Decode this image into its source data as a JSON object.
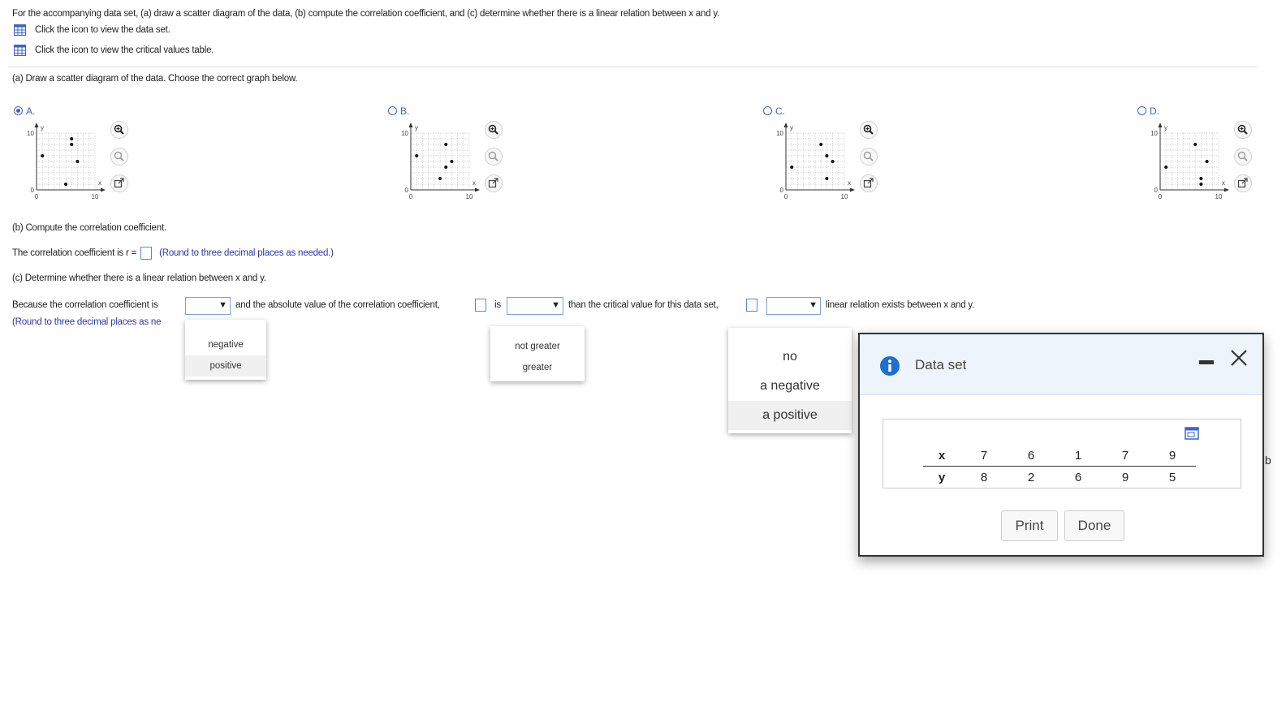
{
  "header": {
    "question": "For the accompanying data set, (a) draw a scatter diagram of the data, (b) compute the correlation coefficient, and (c) determine whether there is a linear relation between x and y.",
    "data_link": "Click the icon to view the data set.",
    "critical_link": "Click the icon to view the critical values table."
  },
  "part_a": {
    "prompt": "(a) Draw a scatter diagram of the data. Choose the correct graph below.",
    "options": [
      {
        "label": "A.",
        "selected": true
      },
      {
        "label": "B.",
        "selected": false
      },
      {
        "label": "C.",
        "selected": false
      },
      {
        "label": "D.",
        "selected": false
      }
    ],
    "axis": {
      "y_top": "10",
      "y_bottom": "0",
      "x_left": "0",
      "x_right": "10",
      "x_name": "x",
      "y_name": "y"
    },
    "graph_points": [
      [
        [
          1,
          6
        ],
        [
          6,
          9
        ],
        [
          6,
          8
        ],
        [
          7,
          5
        ],
        [
          5,
          1
        ]
      ],
      [
        [
          1,
          6
        ],
        [
          6,
          8
        ],
        [
          7,
          5
        ],
        [
          6,
          4
        ],
        [
          5,
          2
        ]
      ],
      [
        [
          1,
          4
        ],
        [
          6,
          8
        ],
        [
          7,
          6
        ],
        [
          8,
          5
        ],
        [
          7,
          2
        ]
      ],
      [
        [
          1,
          4
        ],
        [
          6,
          8
        ],
        [
          8,
          5
        ],
        [
          7,
          2
        ],
        [
          7,
          1
        ]
      ]
    ]
  },
  "part_b": {
    "prompt": "(b) Compute the correlation coefficient.",
    "sentence": "The correlation coefficient is r =",
    "hint": "(Round to three decimal places as needed.)"
  },
  "part_c": {
    "prompt": "(c) Determine whether there is a linear relation between x and y.",
    "s1": "Because the correlation coefficient is",
    "s2": "and the absolute value of the correlation coefficient,",
    "s3": "is",
    "s4": "than the critical value for this data set,",
    "s5": "linear relation exists between x and y.",
    "hint": "(Round to three decimal places as ne"
  },
  "menus": {
    "sign": [
      "negative",
      "positive"
    ],
    "compare": [
      "not greater",
      "greater"
    ],
    "relation": [
      "no",
      "a negative",
      "a positive"
    ]
  },
  "dialog": {
    "title": "Data set",
    "x_label": "x",
    "y_label": "y",
    "x": [
      "7",
      "6",
      "1",
      "7",
      "9"
    ],
    "y": [
      "8",
      "2",
      "6",
      "9",
      "5"
    ],
    "print": "Print",
    "done": "Done"
  },
  "edge_char": "b"
}
